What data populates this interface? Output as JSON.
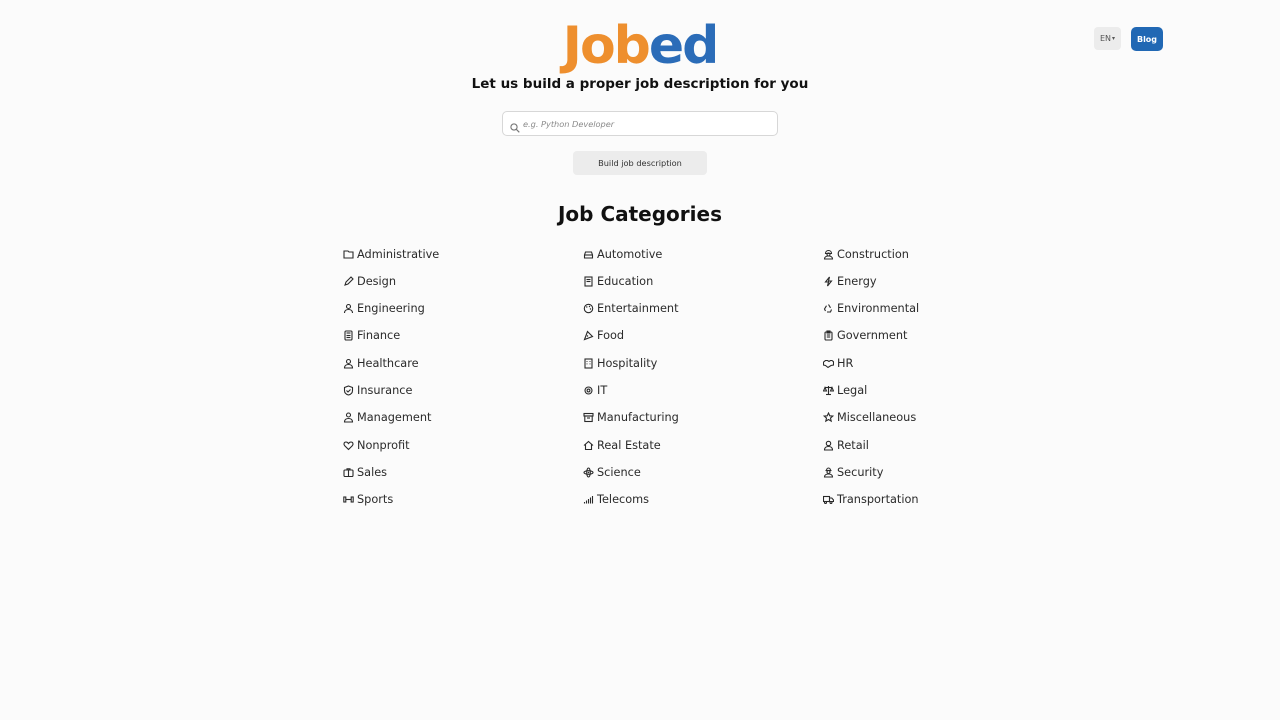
{
  "brand": {
    "logo_part1": "Job",
    "logo_part2": "ed",
    "colors": {
      "orange": "#ee8f2e",
      "blue": "#2b6cb8"
    }
  },
  "header": {
    "language": "EN",
    "blog_label": "Blog",
    "blog_color": "#2168b4"
  },
  "hero": {
    "tagline": "Let us build a proper job description for you",
    "search_placeholder": "e.g. Python Developer",
    "search_icon": "search-icon",
    "build_button": "Build job description"
  },
  "categories": {
    "title": "Job Categories",
    "columns": [
      [
        {
          "label": "Administrative",
          "icon": "folder-icon"
        },
        {
          "label": "Design",
          "icon": "pencil-icon"
        },
        {
          "label": "Engineering",
          "icon": "engineer-icon"
        },
        {
          "label": "Finance",
          "icon": "calculator-icon"
        },
        {
          "label": "Healthcare",
          "icon": "user-doctor-icon"
        },
        {
          "label": "Insurance",
          "icon": "shield-icon"
        },
        {
          "label": "Management",
          "icon": "user-tie-icon"
        },
        {
          "label": "Nonprofit",
          "icon": "heart-icon"
        },
        {
          "label": "Sales",
          "icon": "briefcase-icon"
        },
        {
          "label": "Sports",
          "icon": "dumbbell-icon"
        }
      ],
      [
        {
          "label": "Automotive",
          "icon": "car-icon"
        },
        {
          "label": "Education",
          "icon": "book-icon"
        },
        {
          "label": "Entertainment",
          "icon": "palette-icon"
        },
        {
          "label": "Food",
          "icon": "pizza-icon"
        },
        {
          "label": "Hospitality",
          "icon": "hotel-icon"
        },
        {
          "label": "IT",
          "icon": "gear-icon"
        },
        {
          "label": "Manufacturing",
          "icon": "box-icon"
        },
        {
          "label": "Real Estate",
          "icon": "house-icon"
        },
        {
          "label": "Science",
          "icon": "atom-icon"
        },
        {
          "label": "Telecoms",
          "icon": "signal-icon"
        }
      ],
      [
        {
          "label": "Construction",
          "icon": "helmet-worker-icon"
        },
        {
          "label": "Energy",
          "icon": "bolt-icon"
        },
        {
          "label": "Environmental",
          "icon": "recycle-icon"
        },
        {
          "label": "Government",
          "icon": "clipboard-icon"
        },
        {
          "label": "HR",
          "icon": "handshake-icon"
        },
        {
          "label": "Legal",
          "icon": "scale-icon"
        },
        {
          "label": "Miscellaneous",
          "icon": "star-icon"
        },
        {
          "label": "Retail",
          "icon": "user-icon"
        },
        {
          "label": "Security",
          "icon": "user-secret-icon"
        },
        {
          "label": "Transportation",
          "icon": "truck-icon"
        }
      ]
    ]
  }
}
